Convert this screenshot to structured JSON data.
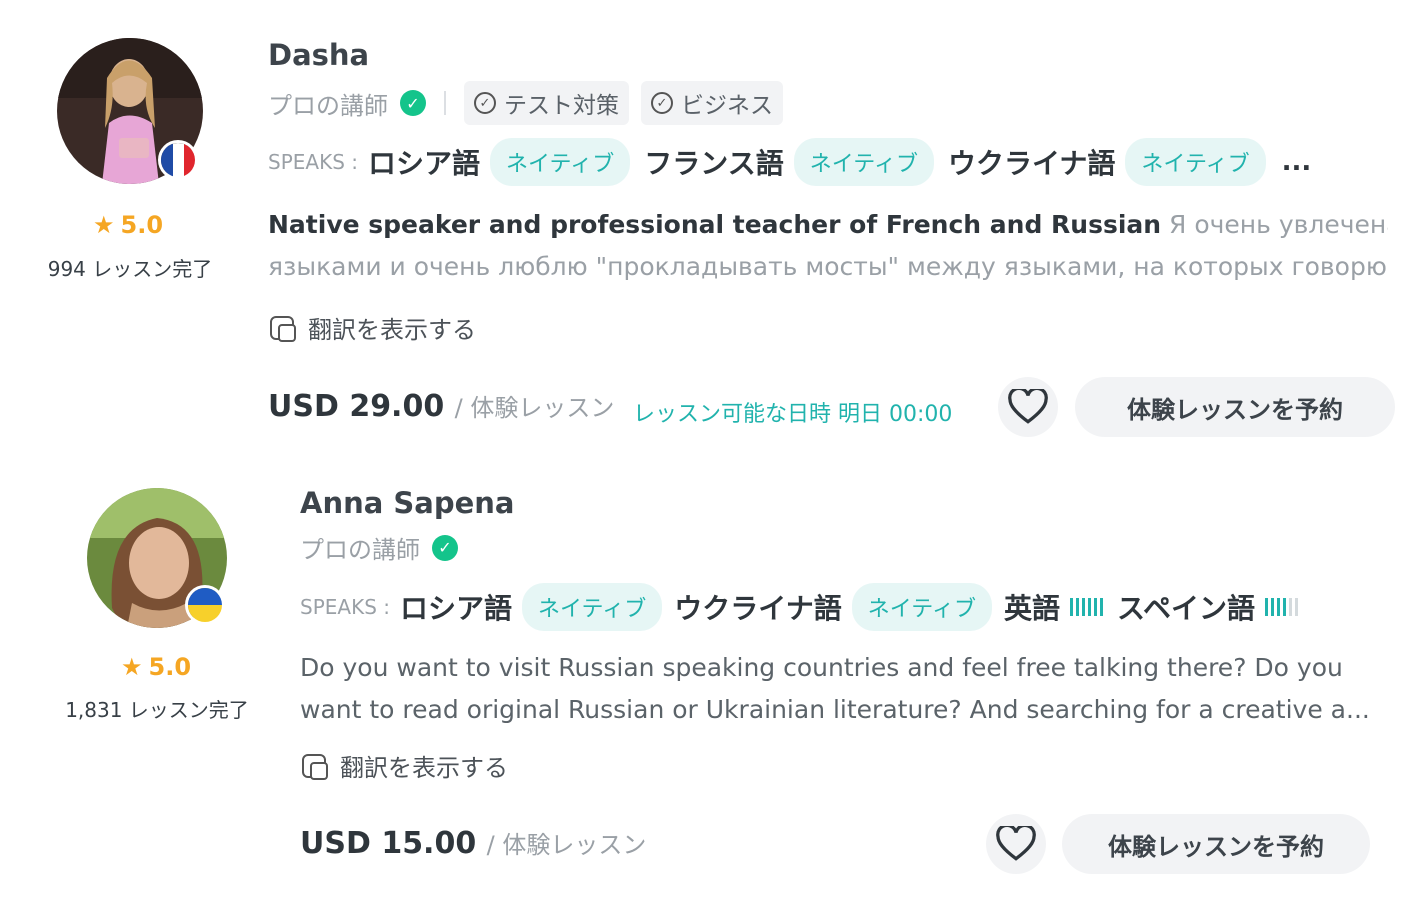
{
  "tutors": [
    {
      "name": "Dasha",
      "pro_label": "プロの講師",
      "tags": [
        "テスト対策",
        "ビジネス"
      ],
      "speaks_label": "SPEAKS :",
      "languages": [
        {
          "lang": "ロシア語",
          "level": "ネイティブ"
        },
        {
          "lang": "フランス語",
          "level": "ネイティブ"
        },
        {
          "lang": "ウクライナ語",
          "level": "ネイティブ"
        }
      ],
      "more": "...",
      "headline": "Native speaker and professional teacher of French and Russian",
      "description_line1": "Я очень увлечена",
      "description_line2": "языками и очень люблю \"прокладывать мосты\" между языками, на которых говорю...",
      "translate_label": "翻訳を表示する",
      "rating": "5.0",
      "lessons": "994 レッスン完了",
      "price": "USD 29.00",
      "price_unit": "/ 体験レッスン",
      "availability": "レッスン可能な日時 明日 00:00",
      "book_label": "体験レッスンを予約",
      "flag": "france-flag"
    },
    {
      "name": "Anna Sapena",
      "pro_label": "プロの講師",
      "speaks_label": "SPEAKS :",
      "languages": [
        {
          "lang": "ロシア語",
          "level": "ネイティブ"
        },
        {
          "lang": "ウクライナ語",
          "level": "ネイティブ"
        },
        {
          "lang": "英語",
          "bars": 6
        },
        {
          "lang": "スペイン語",
          "bars": 4
        }
      ],
      "description_line1": "Do you want to visit Russian speaking countries and feel free talking there? Do you",
      "description_line2": "want to read original Russian or Ukrainian literature? And searching for a creative a...",
      "translate_label": "翻訳を表示する",
      "rating": "5.0",
      "lessons": "1,831 レッスン完了",
      "price": "USD 15.00",
      "price_unit": "/ 体験レッスン",
      "book_label": "体験レッスンを予約",
      "flag": "ukraine-flag"
    }
  ],
  "colors": {
    "accent": "#21b3ad",
    "star": "#f5a623",
    "verified": "#14c48b"
  }
}
